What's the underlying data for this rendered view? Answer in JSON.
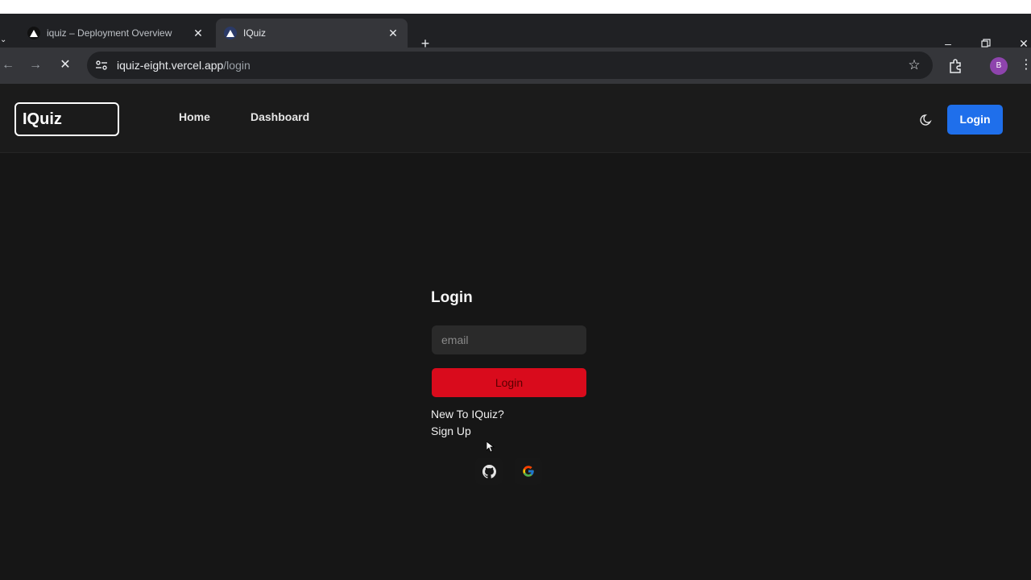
{
  "browser": {
    "tabs": [
      {
        "title": "iquiz – Deployment Overview",
        "active": false,
        "icon": "vercel-triangle-icon"
      },
      {
        "title": "IQuiz",
        "active": true,
        "icon": "vercel-triangle-icon"
      }
    ],
    "url_host": "iquiz-eight.vercel.app",
    "url_path": "/login",
    "profile_initial": "B",
    "colors": {
      "tabbar": "#202124",
      "toolbar": "#35363a",
      "profile": "#8e44ad"
    }
  },
  "header": {
    "logo": "IQuiz",
    "nav": [
      "Home",
      "Dashboard"
    ],
    "login_button": "Login",
    "theme_icon": "moon-icon",
    "colors": {
      "login_button": "#1f6feb"
    }
  },
  "login_form": {
    "title": "Login",
    "email_placeholder": "email",
    "submit_label": "Login",
    "new_to_text": "New To IQuiz?",
    "signup_link": "Sign Up",
    "social_icons": [
      "github-icon",
      "google-icon"
    ],
    "colors": {
      "submit": "#d90b1c"
    }
  }
}
